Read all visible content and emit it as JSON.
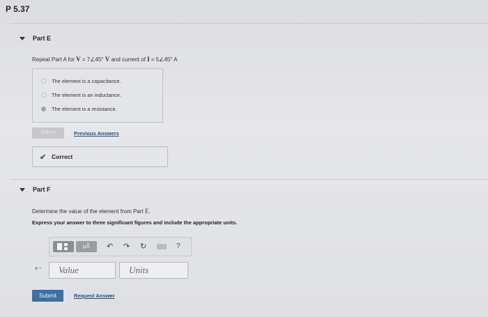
{
  "problem": {
    "title": "P 5.37"
  },
  "part_e": {
    "label": "Part E",
    "question_pre": "Repeat Part A for ",
    "question_v": "V",
    "question_v_eq": " = 7∠45° ",
    "question_v_unit": "V",
    "question_mid": " and current of ",
    "question_i": "I",
    "question_i_eq": " = 5∠45° ",
    "question_i_unit": "A",
    "choices": [
      {
        "label": "The element is a capacitance.",
        "selected": false
      },
      {
        "label": "The element is an inductance.",
        "selected": false
      },
      {
        "label": "The element is a resistance.",
        "selected": true
      }
    ],
    "submit_label": "Submit",
    "previous_answers_label": "Previous Answers",
    "result_label": "Correct"
  },
  "part_f": {
    "label": "Part F",
    "question_pre": "Determine the value of the element from Part ",
    "question_ref": "E",
    "question_post": ".",
    "instruction": "Express your answer to three significant figures and include the appropriate units.",
    "toolbar": {
      "mu_label": "μÅ",
      "undo_icon": "↶",
      "redo_icon": "↷",
      "reset_icon": "↻",
      "help_label": "?"
    },
    "var_label": "R =",
    "value_placeholder": "Value",
    "units_placeholder": "Units",
    "submit_label": "Submit",
    "request_answer_label": "Request Answer"
  }
}
